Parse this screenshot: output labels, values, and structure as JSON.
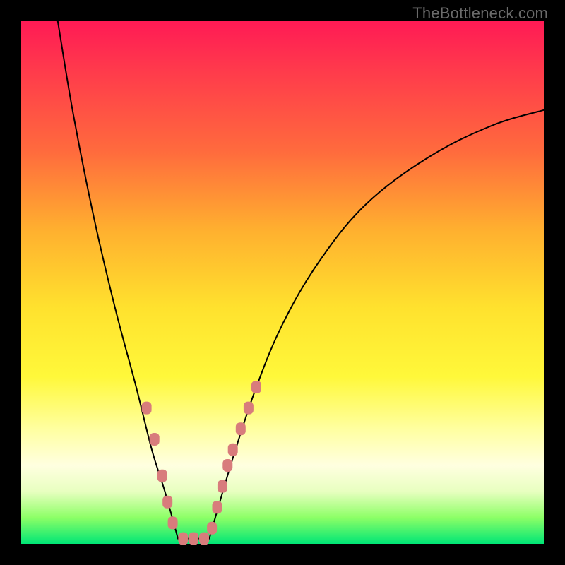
{
  "watermark": "TheBottleneck.com",
  "colors": {
    "curve": "#000000",
    "marker": "#d87c7c",
    "frame_bg": "#000000"
  },
  "chart_data": {
    "type": "line",
    "title": "",
    "xlabel": "",
    "ylabel": "",
    "xlim": [
      0,
      100
    ],
    "ylim": [
      0,
      100
    ],
    "floor_y": 99,
    "valley": {
      "x_start": 30,
      "x_end": 36
    },
    "curve_left": [
      {
        "x": 7,
        "y": 0
      },
      {
        "x": 10,
        "y": 18
      },
      {
        "x": 14,
        "y": 38
      },
      {
        "x": 18,
        "y": 55
      },
      {
        "x": 22,
        "y": 70
      },
      {
        "x": 25,
        "y": 82
      },
      {
        "x": 27.5,
        "y": 90
      },
      {
        "x": 30,
        "y": 99
      }
    ],
    "curve_right": [
      {
        "x": 36,
        "y": 99
      },
      {
        "x": 38,
        "y": 92
      },
      {
        "x": 41,
        "y": 82
      },
      {
        "x": 45,
        "y": 70
      },
      {
        "x": 50,
        "y": 58
      },
      {
        "x": 57,
        "y": 46
      },
      {
        "x": 66,
        "y": 35
      },
      {
        "x": 78,
        "y": 26
      },
      {
        "x": 90,
        "y": 20
      },
      {
        "x": 100,
        "y": 17
      }
    ],
    "markers_left": [
      {
        "x": 24,
        "y": 74
      },
      {
        "x": 25.5,
        "y": 80
      },
      {
        "x": 27,
        "y": 87
      },
      {
        "x": 28,
        "y": 92
      },
      {
        "x": 29,
        "y": 96
      }
    ],
    "markers_floor": [
      {
        "x": 31,
        "y": 99
      },
      {
        "x": 33,
        "y": 99
      },
      {
        "x": 35,
        "y": 99
      }
    ],
    "markers_right": [
      {
        "x": 36.5,
        "y": 97
      },
      {
        "x": 37.5,
        "y": 93
      },
      {
        "x": 38.5,
        "y": 89
      },
      {
        "x": 39.5,
        "y": 85
      },
      {
        "x": 40.5,
        "y": 82
      },
      {
        "x": 42,
        "y": 78
      },
      {
        "x": 43.5,
        "y": 74
      },
      {
        "x": 45,
        "y": 70
      }
    ]
  }
}
